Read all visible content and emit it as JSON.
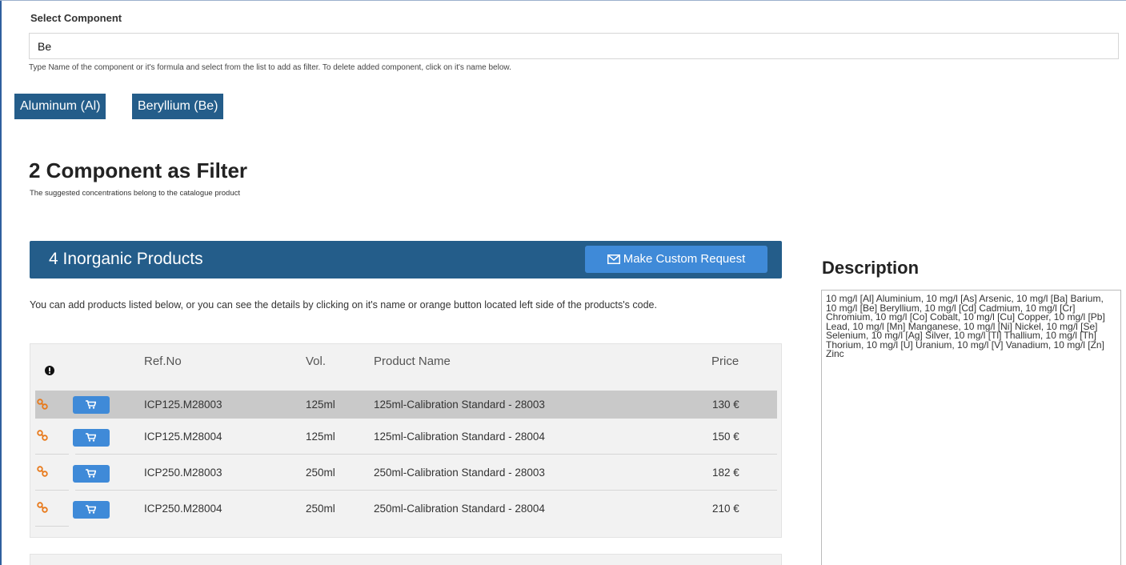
{
  "select_component": {
    "label": "Select Component",
    "value": "Be",
    "help": "Type Name of the component or it's formula and select from the list to add as filter. To delete added component, click on it's name below."
  },
  "chips": [
    "Aluminum (Al)",
    "Beryllium (Be)"
  ],
  "filter": {
    "title": "2 Component as Filter",
    "subtitle": "The suggested concentrations belong to the catalogue product"
  },
  "products": {
    "title": "4 Inorganic Products",
    "custom_request_label": "Make Custom Request",
    "intro": "You can add products listed below, or you can see the details by clicking on it's name or orange button located left side of the products's code.",
    "columns": {
      "ref": "Ref.No",
      "vol": "Vol.",
      "name": "Product Name",
      "price": "Price"
    },
    "rows": [
      {
        "ref": "ICP125.M28003",
        "vol": "125ml",
        "name": "125ml-Calibration Standard - 28003",
        "price": "130 €"
      },
      {
        "ref": "ICP125.M28004",
        "vol": "125ml",
        "name": "125ml-Calibration Standard - 28004",
        "price": "150 €"
      },
      {
        "ref": "ICP250.M28003",
        "vol": "250ml",
        "name": "250ml-Calibration Standard - 28003",
        "price": "182 €"
      },
      {
        "ref": "ICP250.M28004",
        "vol": "250ml",
        "name": "250ml-Calibration Standard - 28004",
        "price": "210 €"
      }
    ]
  },
  "description": {
    "title": "Description",
    "text": "10 mg/l [Al] Aluminium, 10 mg/l [As] Arsenic, 10 mg/l [Ba] Barium, 10 mg/l [Be] Beryllium, 10 mg/l [Cd] Cadmium, 10 mg/l [Cr] Chromium, 10 mg/l [Co] Cobalt, 10 mg/l [Cu] Copper, 10 mg/l [Pb] Lead, 10 mg/l [Mn] Manganese, 10 mg/l [Ni] Nickel, 10 mg/l [Se] Selenium, 10 mg/l [Ag] Silver, 10 mg/l [Tl] Thallium, 10 mg/l [Th] Thorium, 10 mg/l [U] Uranium, 10 mg/l [V] Vanadium, 10 mg/l [Zn] Zinc"
  },
  "colors": {
    "header_blue": "#245d8a",
    "button_blue": "#3f8ad8",
    "link_orange": "#e8791a",
    "row_highlight": "#c9c9c9"
  },
  "icons": {
    "info": "exclamation-circle-icon",
    "row_link": "link-icon",
    "row_cart": "cart-icon",
    "custom_request": "envelope-icon"
  }
}
